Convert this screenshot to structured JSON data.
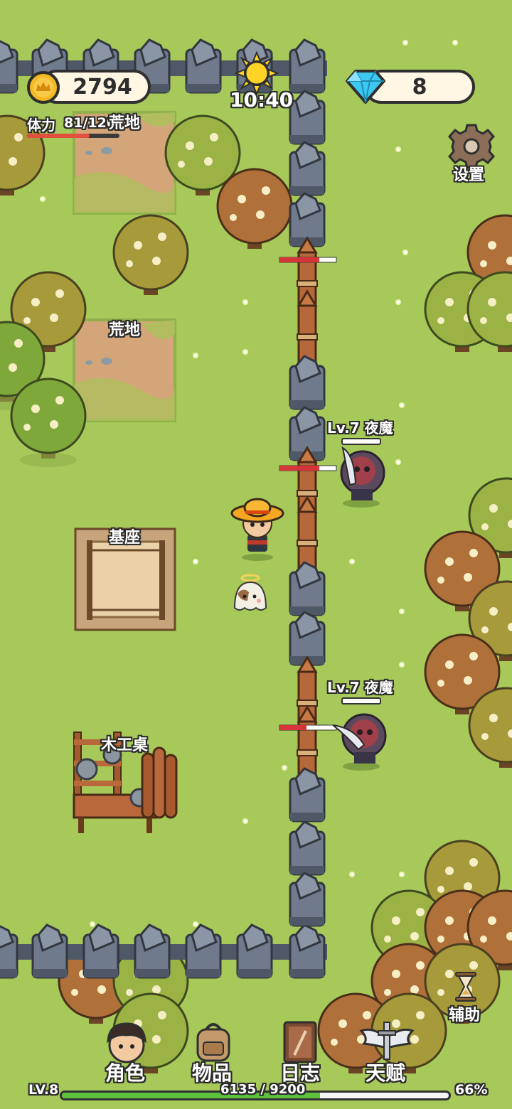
{
  "hud": {
    "coins": "2794",
    "gems": "8",
    "time": "10:40",
    "stamina_label": "体力",
    "stamina_value": "81/120",
    "stamina_fraction": 0.675,
    "settings_label": "设置"
  },
  "map_labels": {
    "wasteland_1": "荒地",
    "wasteland_2": "荒地",
    "pedestal": "基座",
    "workbench": "木工桌"
  },
  "enemies": [
    {
      "label": "Lv.7 夜魔"
    },
    {
      "label": "Lv.7 夜魔"
    }
  ],
  "assist_label": "辅助",
  "nav": {
    "character": "角色",
    "items": "物品",
    "journal": "日志",
    "talent": "天赋"
  },
  "xp": {
    "level": "LV.8",
    "value": "6135 / 9200",
    "percent": "66%",
    "fraction": 0.667
  },
  "colors": {
    "grass": "#a7c95a",
    "xp_fill": "#5cc23c",
    "stamina_fill": "#e0503c",
    "gem": "#3cc8f0",
    "coin": "#f5b922"
  }
}
